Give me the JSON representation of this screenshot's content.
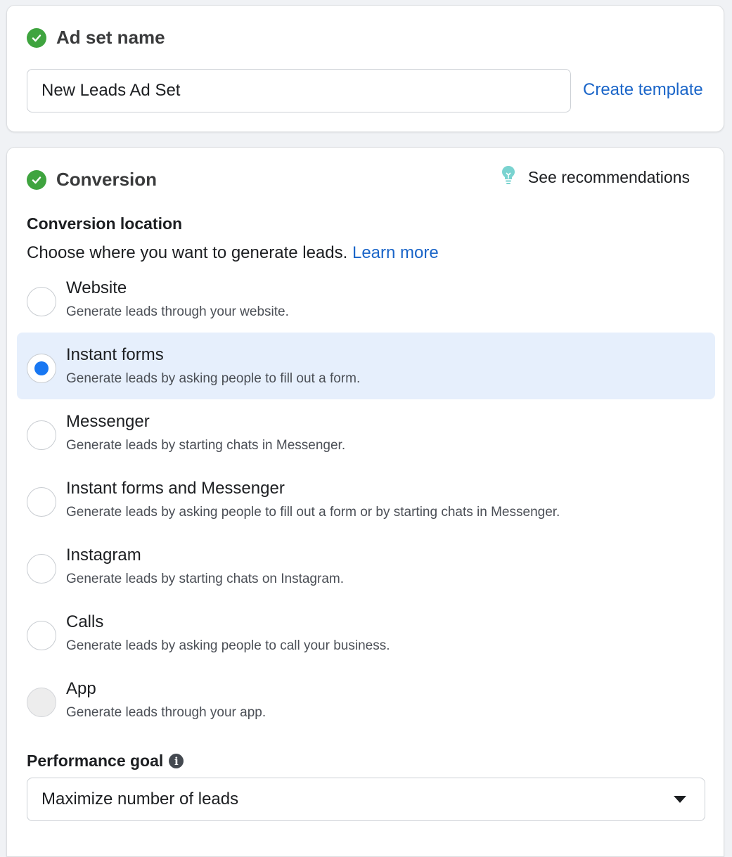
{
  "ad_set": {
    "title": "Ad set name",
    "name_value": "New Leads Ad Set",
    "create_template_label": "Create template"
  },
  "conversion": {
    "title": "Conversion",
    "recommendations_label": "See recommendations",
    "location_heading": "Conversion location",
    "description": "Choose where you want to generate leads.",
    "learn_more_label": "Learn more",
    "selected_option": "Instant forms",
    "options": [
      {
        "label": "Website",
        "description": "Generate leads through your website."
      },
      {
        "label": "Instant forms",
        "description": "Generate leads by asking people to fill out a form."
      },
      {
        "label": "Messenger",
        "description": "Generate leads by starting chats in Messenger."
      },
      {
        "label": "Instant forms and Messenger",
        "description": "Generate leads by asking people to fill out a form or by starting chats in Messenger."
      },
      {
        "label": "Instagram",
        "description": "Generate leads by starting chats on Instagram."
      },
      {
        "label": "Calls",
        "description": "Generate leads by asking people to call your business."
      },
      {
        "label": "App",
        "description": "Generate leads through your app."
      }
    ]
  },
  "performance_goal": {
    "heading": "Performance goal",
    "selected_value": "Maximize number of leads"
  },
  "colors": {
    "accent": "#1877f2",
    "link": "#1a65c8",
    "success": "#3fa43f",
    "selected_bg": "#e6effc"
  },
  "icons": [
    "check-circle-icon",
    "lightbulb-icon",
    "info-icon",
    "caret-down-icon"
  ]
}
